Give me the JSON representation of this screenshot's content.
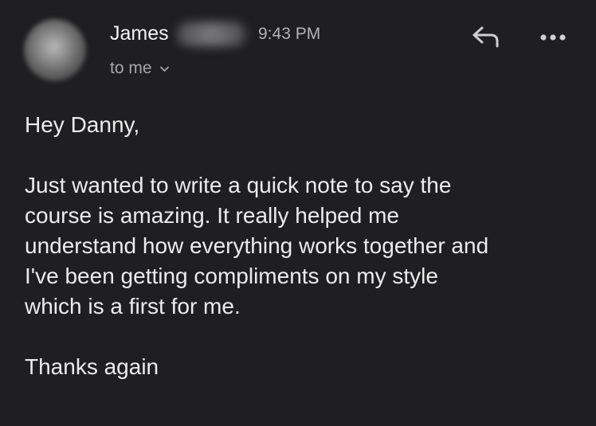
{
  "email": {
    "sender_name": "James",
    "time": "9:43 PM",
    "recipient_label": "to me",
    "greeting": "Hey Danny,",
    "body_lines": [
      "Just wanted to write a quick note to say the",
      "course is amazing. It really helped me",
      "understand how everything works together and",
      "I've been getting compliments on my style",
      "which is a first for me."
    ],
    "closing": "Thanks again"
  },
  "icons": {
    "reply": "reply-arrow-icon",
    "more": "more-dots-icon",
    "expand": "chevron-down-icon"
  },
  "colors": {
    "background": "#1f1f21",
    "text": "#ececec",
    "secondary_text": "#a7a7aa"
  }
}
